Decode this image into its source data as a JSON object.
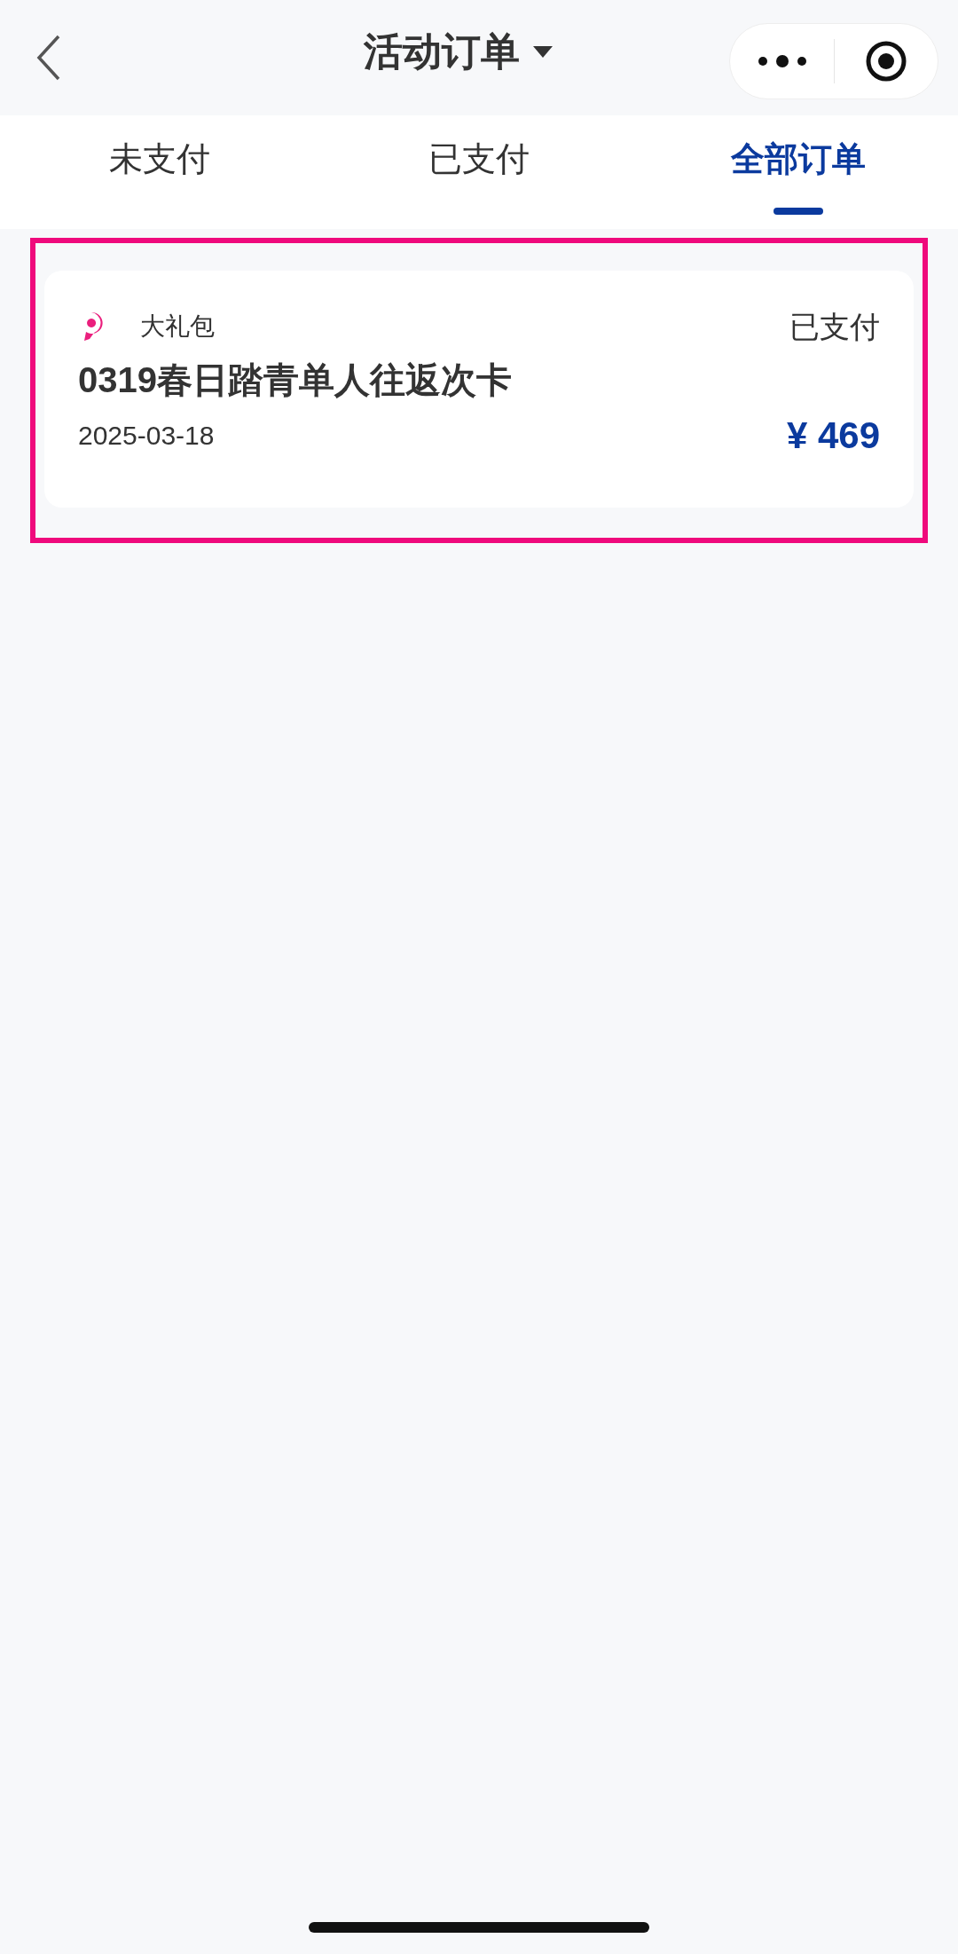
{
  "header": {
    "title": "活动订单"
  },
  "tabs": [
    {
      "label": "未支付",
      "selected": false
    },
    {
      "label": "已支付",
      "selected": false
    },
    {
      "label": "全部订单",
      "selected": true
    }
  ],
  "orders": [
    {
      "category": "大礼包",
      "status": "已支付",
      "name": "0319春日踏青单人往返次卡",
      "date": "2025-03-18",
      "price": "¥ 469",
      "highlighted": true
    }
  ]
}
